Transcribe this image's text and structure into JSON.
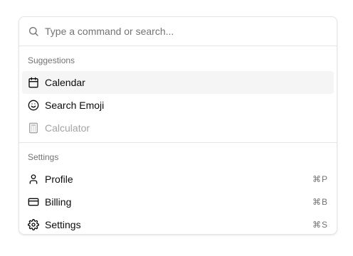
{
  "search": {
    "placeholder": "Type a command or search...",
    "icon": "search-icon"
  },
  "groups": [
    {
      "heading": "Suggestions",
      "items": [
        {
          "label": "Calendar",
          "icon": "calendar-icon",
          "selected": true,
          "disabled": false
        },
        {
          "label": "Search Emoji",
          "icon": "smile-icon",
          "selected": false,
          "disabled": false
        },
        {
          "label": "Calculator",
          "icon": "calculator-icon",
          "selected": false,
          "disabled": true
        }
      ]
    },
    {
      "heading": "Settings",
      "items": [
        {
          "label": "Profile",
          "icon": "user-icon",
          "shortcut": "⌘P"
        },
        {
          "label": "Billing",
          "icon": "credit-card-icon",
          "shortcut": "⌘B"
        },
        {
          "label": "Settings",
          "icon": "gear-icon",
          "shortcut": "⌘S"
        }
      ]
    }
  ],
  "colors": {
    "border": "#e5e5e5",
    "muted_text": "#737373",
    "disabled_text": "#a3a3a3",
    "selected_bg": "#f5f5f5"
  }
}
